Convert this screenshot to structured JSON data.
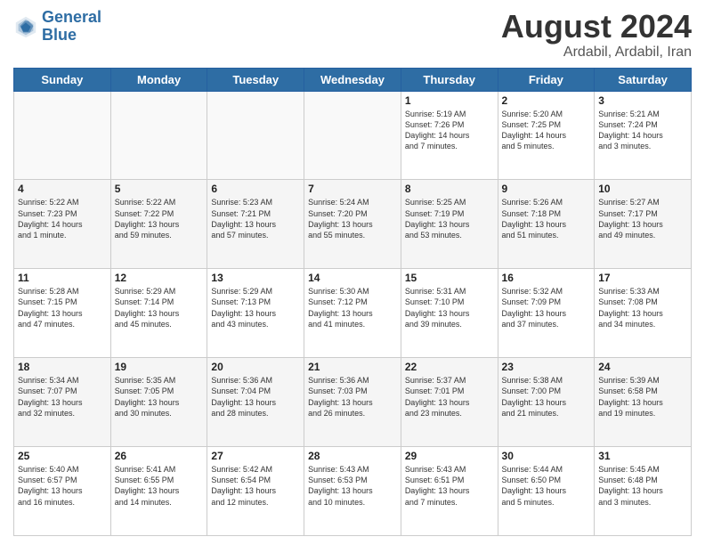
{
  "header": {
    "logo_line1": "General",
    "logo_line2": "Blue",
    "month_year": "August 2024",
    "location": "Ardabil, Ardabil, Iran"
  },
  "days_of_week": [
    "Sunday",
    "Monday",
    "Tuesday",
    "Wednesday",
    "Thursday",
    "Friday",
    "Saturday"
  ],
  "weeks": [
    [
      {
        "day": "",
        "text": ""
      },
      {
        "day": "",
        "text": ""
      },
      {
        "day": "",
        "text": ""
      },
      {
        "day": "",
        "text": ""
      },
      {
        "day": "1",
        "text": "Sunrise: 5:19 AM\nSunset: 7:26 PM\nDaylight: 14 hours\nand 7 minutes."
      },
      {
        "day": "2",
        "text": "Sunrise: 5:20 AM\nSunset: 7:25 PM\nDaylight: 14 hours\nand 5 minutes."
      },
      {
        "day": "3",
        "text": "Sunrise: 5:21 AM\nSunset: 7:24 PM\nDaylight: 14 hours\nand 3 minutes."
      }
    ],
    [
      {
        "day": "4",
        "text": "Sunrise: 5:22 AM\nSunset: 7:23 PM\nDaylight: 14 hours\nand 1 minute."
      },
      {
        "day": "5",
        "text": "Sunrise: 5:22 AM\nSunset: 7:22 PM\nDaylight: 13 hours\nand 59 minutes."
      },
      {
        "day": "6",
        "text": "Sunrise: 5:23 AM\nSunset: 7:21 PM\nDaylight: 13 hours\nand 57 minutes."
      },
      {
        "day": "7",
        "text": "Sunrise: 5:24 AM\nSunset: 7:20 PM\nDaylight: 13 hours\nand 55 minutes."
      },
      {
        "day": "8",
        "text": "Sunrise: 5:25 AM\nSunset: 7:19 PM\nDaylight: 13 hours\nand 53 minutes."
      },
      {
        "day": "9",
        "text": "Sunrise: 5:26 AM\nSunset: 7:18 PM\nDaylight: 13 hours\nand 51 minutes."
      },
      {
        "day": "10",
        "text": "Sunrise: 5:27 AM\nSunset: 7:17 PM\nDaylight: 13 hours\nand 49 minutes."
      }
    ],
    [
      {
        "day": "11",
        "text": "Sunrise: 5:28 AM\nSunset: 7:15 PM\nDaylight: 13 hours\nand 47 minutes."
      },
      {
        "day": "12",
        "text": "Sunrise: 5:29 AM\nSunset: 7:14 PM\nDaylight: 13 hours\nand 45 minutes."
      },
      {
        "day": "13",
        "text": "Sunrise: 5:29 AM\nSunset: 7:13 PM\nDaylight: 13 hours\nand 43 minutes."
      },
      {
        "day": "14",
        "text": "Sunrise: 5:30 AM\nSunset: 7:12 PM\nDaylight: 13 hours\nand 41 minutes."
      },
      {
        "day": "15",
        "text": "Sunrise: 5:31 AM\nSunset: 7:10 PM\nDaylight: 13 hours\nand 39 minutes."
      },
      {
        "day": "16",
        "text": "Sunrise: 5:32 AM\nSunset: 7:09 PM\nDaylight: 13 hours\nand 37 minutes."
      },
      {
        "day": "17",
        "text": "Sunrise: 5:33 AM\nSunset: 7:08 PM\nDaylight: 13 hours\nand 34 minutes."
      }
    ],
    [
      {
        "day": "18",
        "text": "Sunrise: 5:34 AM\nSunset: 7:07 PM\nDaylight: 13 hours\nand 32 minutes."
      },
      {
        "day": "19",
        "text": "Sunrise: 5:35 AM\nSunset: 7:05 PM\nDaylight: 13 hours\nand 30 minutes."
      },
      {
        "day": "20",
        "text": "Sunrise: 5:36 AM\nSunset: 7:04 PM\nDaylight: 13 hours\nand 28 minutes."
      },
      {
        "day": "21",
        "text": "Sunrise: 5:36 AM\nSunset: 7:03 PM\nDaylight: 13 hours\nand 26 minutes."
      },
      {
        "day": "22",
        "text": "Sunrise: 5:37 AM\nSunset: 7:01 PM\nDaylight: 13 hours\nand 23 minutes."
      },
      {
        "day": "23",
        "text": "Sunrise: 5:38 AM\nSunset: 7:00 PM\nDaylight: 13 hours\nand 21 minutes."
      },
      {
        "day": "24",
        "text": "Sunrise: 5:39 AM\nSunset: 6:58 PM\nDaylight: 13 hours\nand 19 minutes."
      }
    ],
    [
      {
        "day": "25",
        "text": "Sunrise: 5:40 AM\nSunset: 6:57 PM\nDaylight: 13 hours\nand 16 minutes."
      },
      {
        "day": "26",
        "text": "Sunrise: 5:41 AM\nSunset: 6:55 PM\nDaylight: 13 hours\nand 14 minutes."
      },
      {
        "day": "27",
        "text": "Sunrise: 5:42 AM\nSunset: 6:54 PM\nDaylight: 13 hours\nand 12 minutes."
      },
      {
        "day": "28",
        "text": "Sunrise: 5:43 AM\nSunset: 6:53 PM\nDaylight: 13 hours\nand 10 minutes."
      },
      {
        "day": "29",
        "text": "Sunrise: 5:43 AM\nSunset: 6:51 PM\nDaylight: 13 hours\nand 7 minutes."
      },
      {
        "day": "30",
        "text": "Sunrise: 5:44 AM\nSunset: 6:50 PM\nDaylight: 13 hours\nand 5 minutes."
      },
      {
        "day": "31",
        "text": "Sunrise: 5:45 AM\nSunset: 6:48 PM\nDaylight: 13 hours\nand 3 minutes."
      }
    ]
  ]
}
